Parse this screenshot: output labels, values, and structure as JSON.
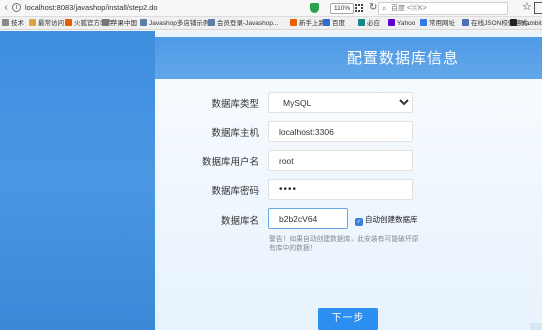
{
  "browser": {
    "url": "localhost:8083/javashop/install/step2.do",
    "zoom": "110%",
    "search_placeholder": "百度 <⌘K>"
  },
  "bookmarks": [
    {
      "label": "技术",
      "color": "#8a8a8a"
    },
    {
      "label": "最常访问",
      "color": "#d9a441"
    },
    {
      "label": "火狐官方站点",
      "color": "#e66000"
    },
    {
      "label": "苹果中国",
      "color": "#777777"
    },
    {
      "label": "Javashop多店铺示例...",
      "color": "#5b7da8"
    },
    {
      "label": "会员登录-Javashop...",
      "color": "#5b7da8"
    },
    {
      "label": "新手上路",
      "color": "#e66000"
    },
    {
      "label": "百度",
      "color": "#2b6fd6"
    },
    {
      "label": "必应",
      "color": "#138a8a"
    },
    {
      "label": "Yahoo",
      "color": "#5f01d1"
    },
    {
      "label": "常用网址",
      "color": "#2f7be0"
    },
    {
      "label": "在线JSON校验格式...",
      "color": "#4d6fb3"
    },
    {
      "label": "Teambition",
      "color": "#222222"
    }
  ],
  "form": {
    "title": "配置数据库信息",
    "db_type_label": "数据库类型",
    "db_type_value": "MySQL",
    "db_host_label": "数据库主机",
    "db_host_value": "localhost:3306",
    "db_user_label": "数据库用户名",
    "db_user_value": "root",
    "db_password_label": "数据库密码",
    "db_password_value": "••••",
    "db_name_label": "数据库名",
    "db_name_value": "b2b2cV64",
    "auto_create_label": "自动创建数据库",
    "auto_create_checked": true,
    "warning": "警告！如果自动创建数据库，此安装有可能破坏原有库中的数据！",
    "next_button": "下一步"
  },
  "colors": {
    "accent": "#2b8ef0",
    "header_blue": "#4f9ae6",
    "page_bg": "#eaf4fc"
  }
}
